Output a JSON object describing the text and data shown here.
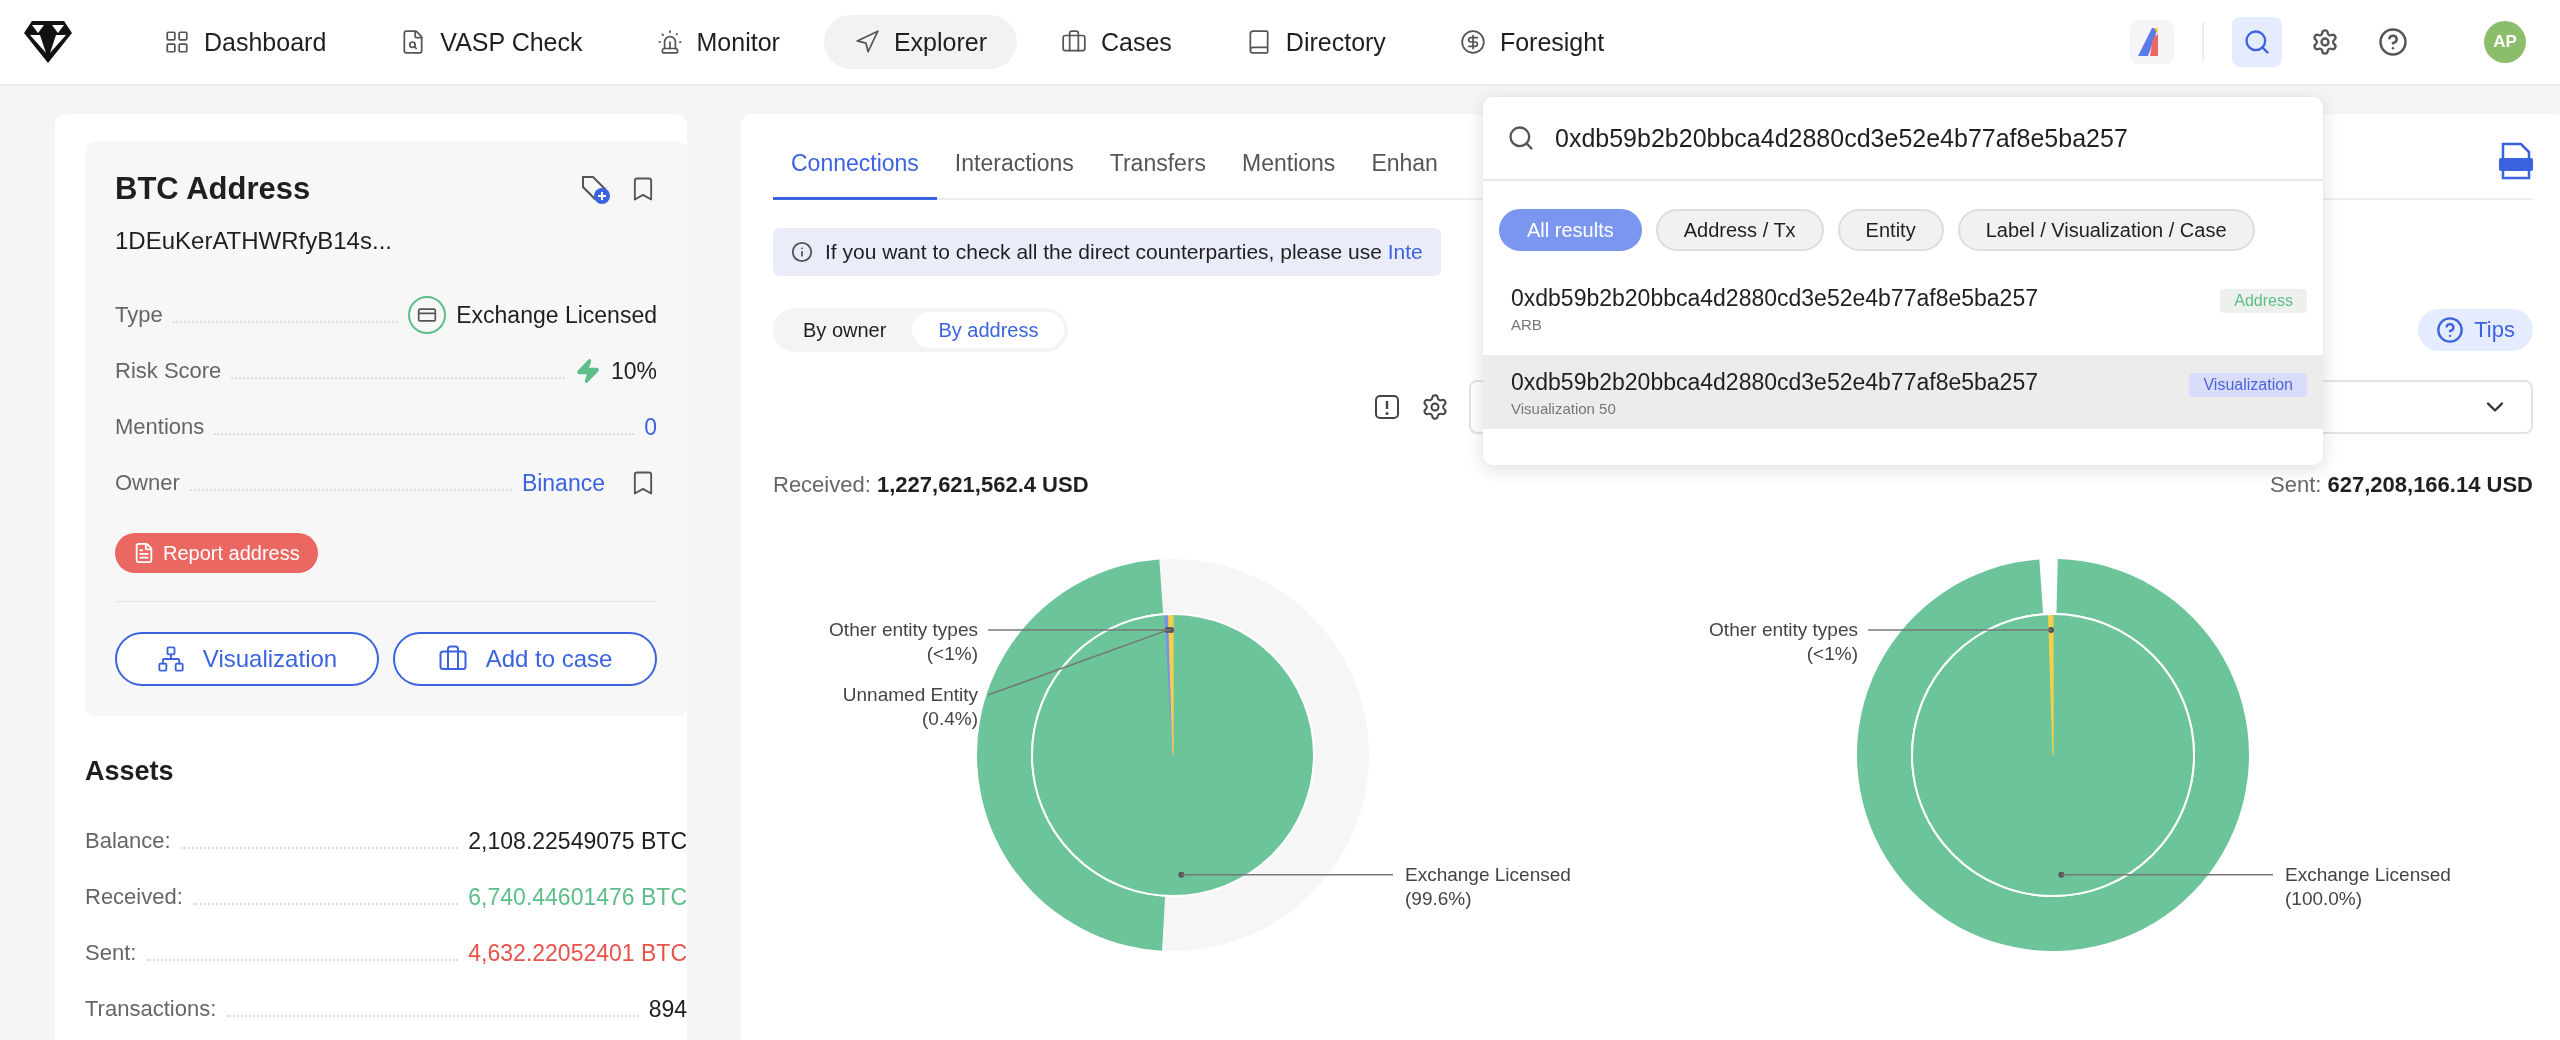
{
  "nav": {
    "items": [
      {
        "label": "Dashboard",
        "selected": false
      },
      {
        "label": "VASP Check",
        "selected": false
      },
      {
        "label": "Monitor",
        "selected": false
      },
      {
        "label": "Explorer",
        "selected": true
      },
      {
        "label": "Cases",
        "selected": false
      },
      {
        "label": "Directory",
        "selected": false
      },
      {
        "label": "Foresight",
        "selected": false
      }
    ],
    "search_active": true,
    "avatar": "AP"
  },
  "address_card": {
    "title": "BTC Address",
    "address": "1DEuKerATHWRfyB14s...",
    "details": [
      {
        "label": "Type",
        "value": "Exchange Licensed",
        "kind": "type"
      },
      {
        "label": "Risk Score",
        "value": "10%",
        "kind": "risk"
      },
      {
        "label": "Mentions",
        "value": "0",
        "kind": "link"
      },
      {
        "label": "Owner",
        "value": "Binance",
        "kind": "owner"
      }
    ],
    "report_button": "Report address",
    "actions": [
      "Visualization",
      "Add to case"
    ]
  },
  "assets": {
    "title": "Assets",
    "rows": [
      {
        "label": "Balance:",
        "value": "2,108.22549075 BTC",
        "color": "#1f1f1f"
      },
      {
        "label": "Received:",
        "value": "6,740.44601476 BTC",
        "color": "#5cbf8a"
      },
      {
        "label": "Sent:",
        "value": "4,632.22052401 BTC",
        "color": "#e8524a"
      },
      {
        "label": "Transactions:",
        "value": "894",
        "color": "#1f1f1f"
      }
    ]
  },
  "tabs": [
    {
      "label": "Connections",
      "selected": true
    },
    {
      "label": "Interactions",
      "selected": false
    },
    {
      "label": "Transfers",
      "selected": false
    },
    {
      "label": "Mentions",
      "selected": false
    },
    {
      "label": "Enhan",
      "selected": false
    }
  ],
  "info_banner": {
    "text": "If you want to check all the direct counterparties, please use",
    "link": "Inte"
  },
  "view_toggle": [
    {
      "label": "By owner",
      "selected": false
    },
    {
      "label": "By address",
      "selected": true
    }
  ],
  "tips_button": "Tips",
  "totals": {
    "received_label": "Received:",
    "received": "1,227,621,562.4 USD",
    "sent_label": "Sent:",
    "sent": "627,208,166.14 USD"
  },
  "charts": [
    {
      "chart_data": {
        "type": "pie",
        "categories": [
          "Exchange Licensed",
          "Unnamed Entity",
          "Other entity types"
        ],
        "colors": [
          "#6cc49a",
          "#7b8ff0",
          "#f5d04a"
        ],
        "series": [
          {
            "values": [
              99.6,
              0.4,
              0.5
            ]
          }
        ],
        "value_labels": [
          "(99.6%)",
          "(0.4%)",
          "(<1%)"
        ]
      },
      "ring": {
        "level": 0.48
      }
    },
    {
      "chart_data": {
        "type": "pie",
        "categories": [
          "Exchange Licensed",
          "Other entity types"
        ],
        "colors": [
          "#6cc49a",
          "#f5d04a"
        ],
        "series": [
          {
            "values": [
              100.0,
              0.5
            ]
          }
        ],
        "value_labels": [
          "(100.0%)",
          "(<1%)"
        ]
      },
      "ring": {
        "level": 0.985
      }
    }
  ],
  "search": {
    "query": "0xdb59b2b20bbca4d2880cd3e52e4b77af8e5ba257",
    "filters": [
      {
        "label": "All results",
        "selected": true
      },
      {
        "label": "Address / Tx",
        "selected": false
      },
      {
        "label": "Entity",
        "selected": false
      },
      {
        "label": "Label / Visualization / Case",
        "selected": false
      }
    ],
    "results": [
      {
        "title": "0xdb59b2b20bbca4d2880cd3e52e4b77af8e5ba257",
        "subtitle": "ARB",
        "tag": "Address",
        "kind": "address",
        "selected": false
      },
      {
        "title": "0xdb59b2b20bbca4d2880cd3e52e4b77af8e5ba257",
        "subtitle": "Visualization 50",
        "tag": "Visualization",
        "kind": "visualization",
        "selected": true
      }
    ]
  }
}
